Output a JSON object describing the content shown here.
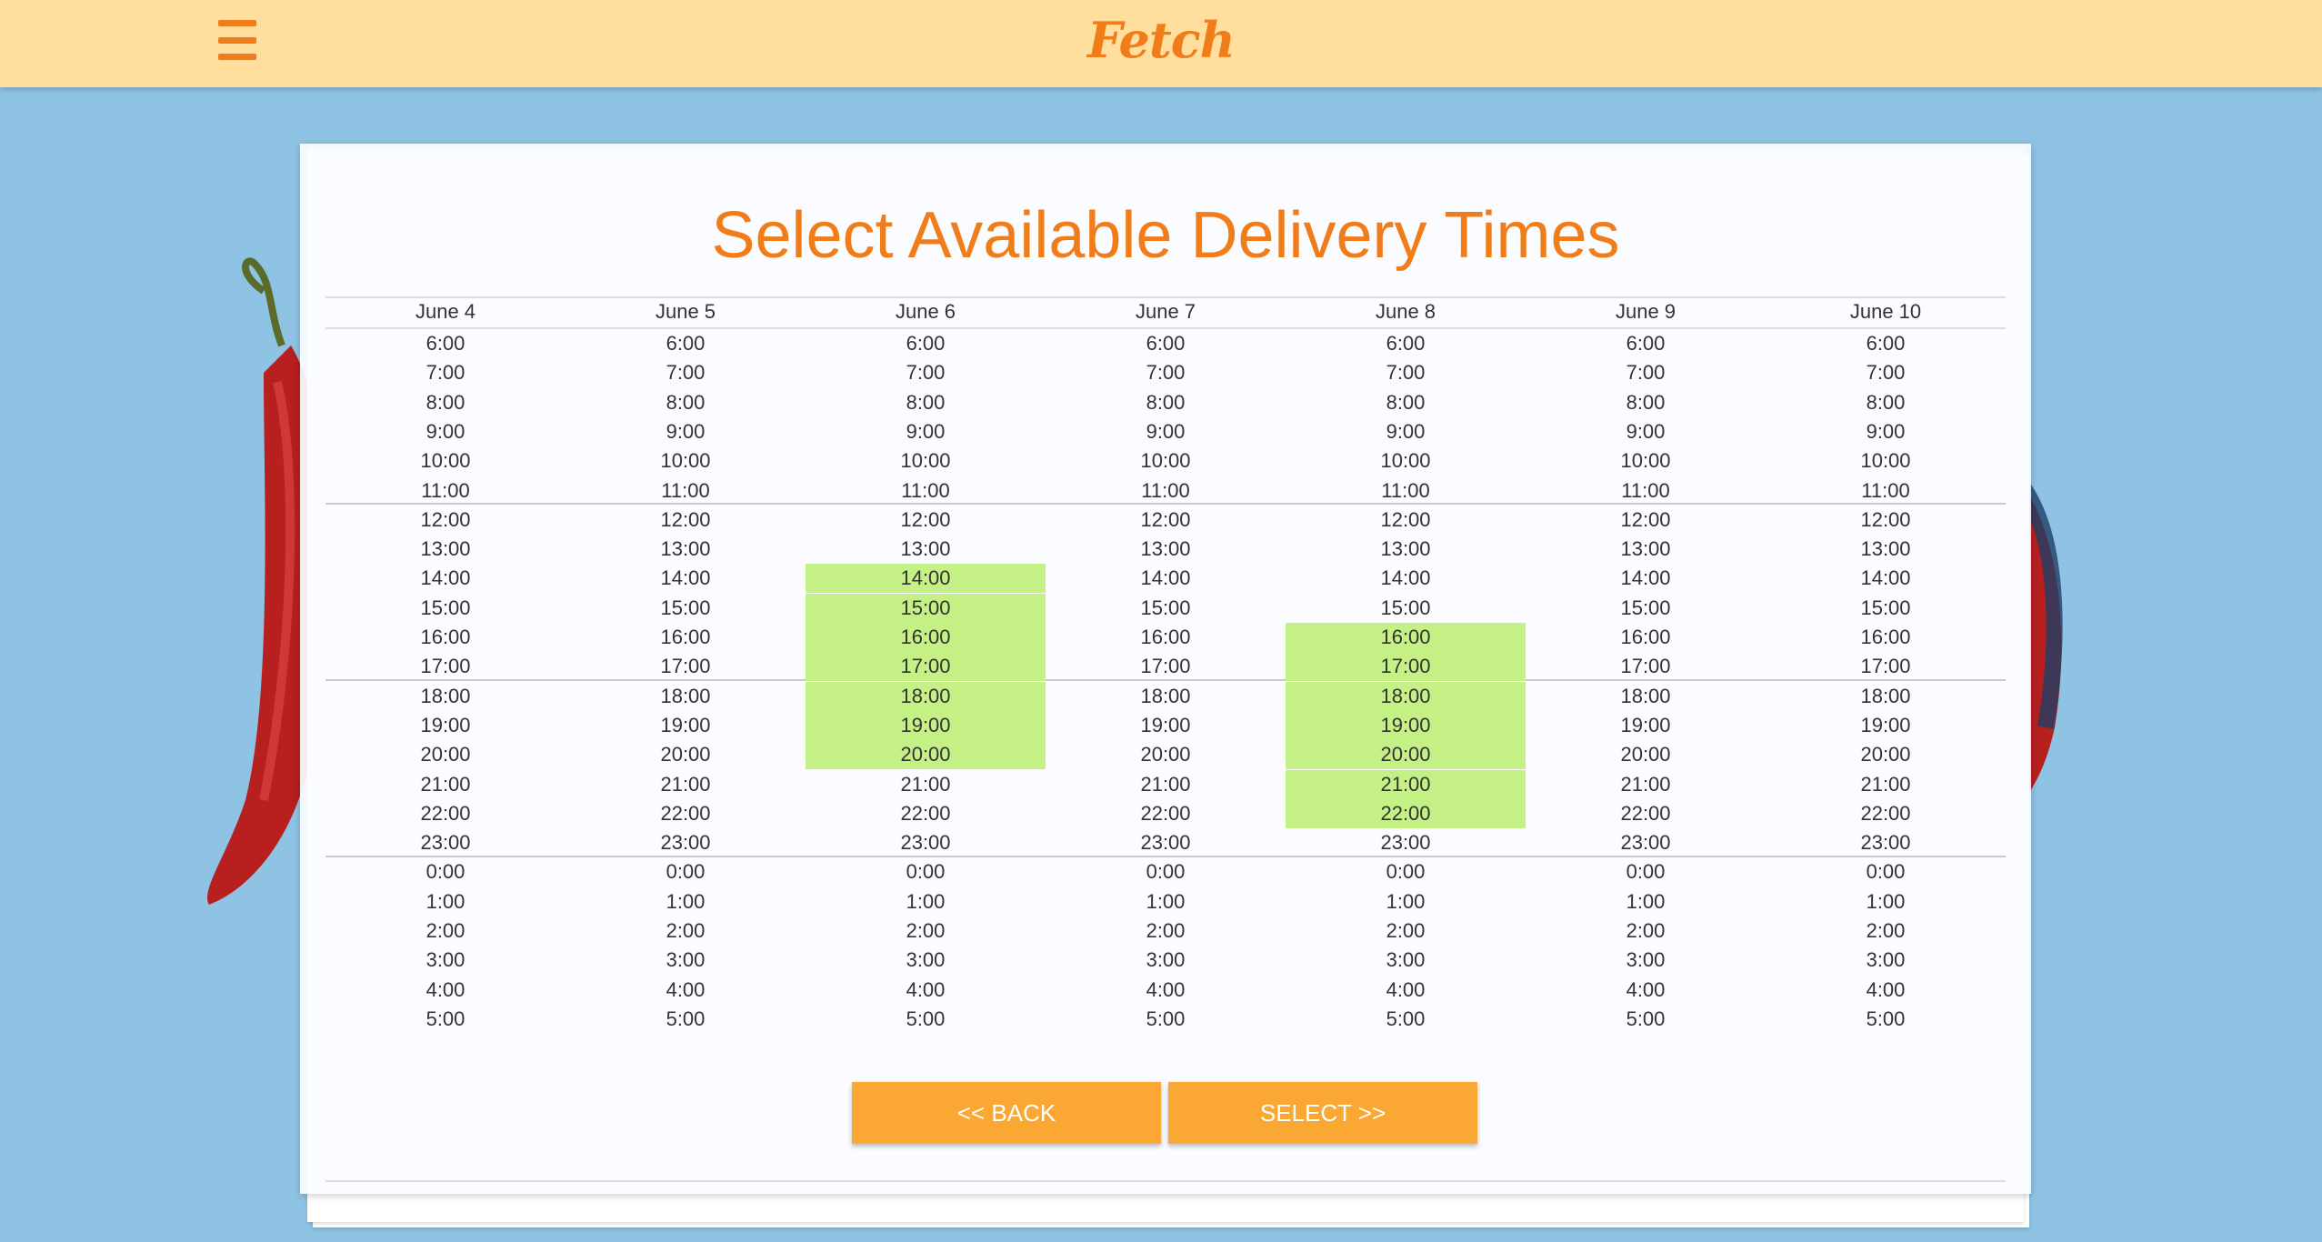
{
  "app": {
    "logo": "Fetch"
  },
  "header": {
    "menu_icon": "hamburger-menu-icon"
  },
  "colors": {
    "topbar": "#ffde9e",
    "accent": "#f07d1a",
    "button": "#fba733",
    "selected": "#c5f085",
    "background": "#8fc3e4"
  },
  "page": {
    "title": "Select Available Delivery Times"
  },
  "schedule": {
    "days": [
      {
        "label": "June 4",
        "selected": []
      },
      {
        "label": "June 5",
        "selected": []
      },
      {
        "label": "June 6",
        "selected": [
          "14:00",
          "15:00",
          "16:00",
          "17:00",
          "18:00",
          "19:00",
          "20:00"
        ]
      },
      {
        "label": "June 7",
        "selected": []
      },
      {
        "label": "June 8",
        "selected": [
          "16:00",
          "17:00",
          "18:00",
          "19:00",
          "20:00",
          "21:00",
          "22:00"
        ]
      },
      {
        "label": "June 9",
        "selected": []
      },
      {
        "label": "June 10",
        "selected": []
      }
    ],
    "times": [
      "6:00",
      "7:00",
      "8:00",
      "9:00",
      "10:00",
      "11:00",
      "12:00",
      "13:00",
      "14:00",
      "15:00",
      "16:00",
      "17:00",
      "18:00",
      "19:00",
      "20:00",
      "21:00",
      "22:00",
      "23:00",
      "0:00",
      "1:00",
      "2:00",
      "3:00",
      "4:00",
      "5:00"
    ]
  },
  "buttons": {
    "back": "<< BACK",
    "select": "SELECT >>"
  }
}
